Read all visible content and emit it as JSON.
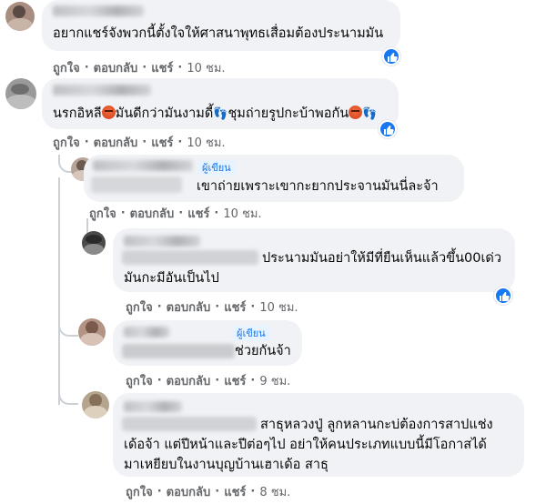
{
  "colors": {
    "link": "#1877f2",
    "muted": "#65676b",
    "bubble": "#f0f2f5"
  },
  "labels": {
    "like": "ถูกใจ",
    "reply": "ตอบกลับ",
    "share": "แชร์"
  },
  "author_badge": "ผู้เขียน",
  "comments": [
    {
      "text_lines": [
        "อยากแชร์จังพวกนี้ตั้งใจให้ศาสนาพุทธเสื่อมต้องประนามมัน"
      ],
      "time": "10 ชม.",
      "has_like": true
    },
    {
      "text_segments": [
        "นรกอิหลี",
        "มันดีกว่ามันงามดี้",
        "ชุมถ่ายรูปกะบ้าพอกัน"
      ],
      "time": "10 ชม.",
      "has_like": true
    },
    {
      "author": true,
      "text_lines": [
        "เขาถ่ายเพราะเขากะยากประจานมันนี่ละจ้า"
      ],
      "time": "10 ชม.",
      "has_like": false
    },
    {
      "text_lines": [
        "ประนามมันอย่าให้มีที่ยืนเห็นแล้วขึ้น00เด่ว",
        "มันกะมีอันเป็นไป"
      ],
      "time": "10 ชม.",
      "has_like": true
    },
    {
      "author": true,
      "text_lines": [
        "ช่วยกันจ้า"
      ],
      "time": "9 ชม.",
      "has_like": false
    },
    {
      "text_lines": [
        "สาธุหลวงปู่ ลูกหลานกะบ่ต้องการสาปแช่ง",
        "เด้อจ้า แต่ปีหน้าและปีต่อๆไป อย่าให้คนประเภทแบบนี้มีโอกาสได้",
        "มาเหยียบในงานบุญบ้านเฮาเด้อ สาธุ"
      ],
      "time": "8 ชม.",
      "has_like": false
    }
  ],
  "separator": "·",
  "icons": {
    "like": "thumbs-up-icon",
    "angry": "angry-face-icon",
    "feet": "footprints-icon"
  }
}
